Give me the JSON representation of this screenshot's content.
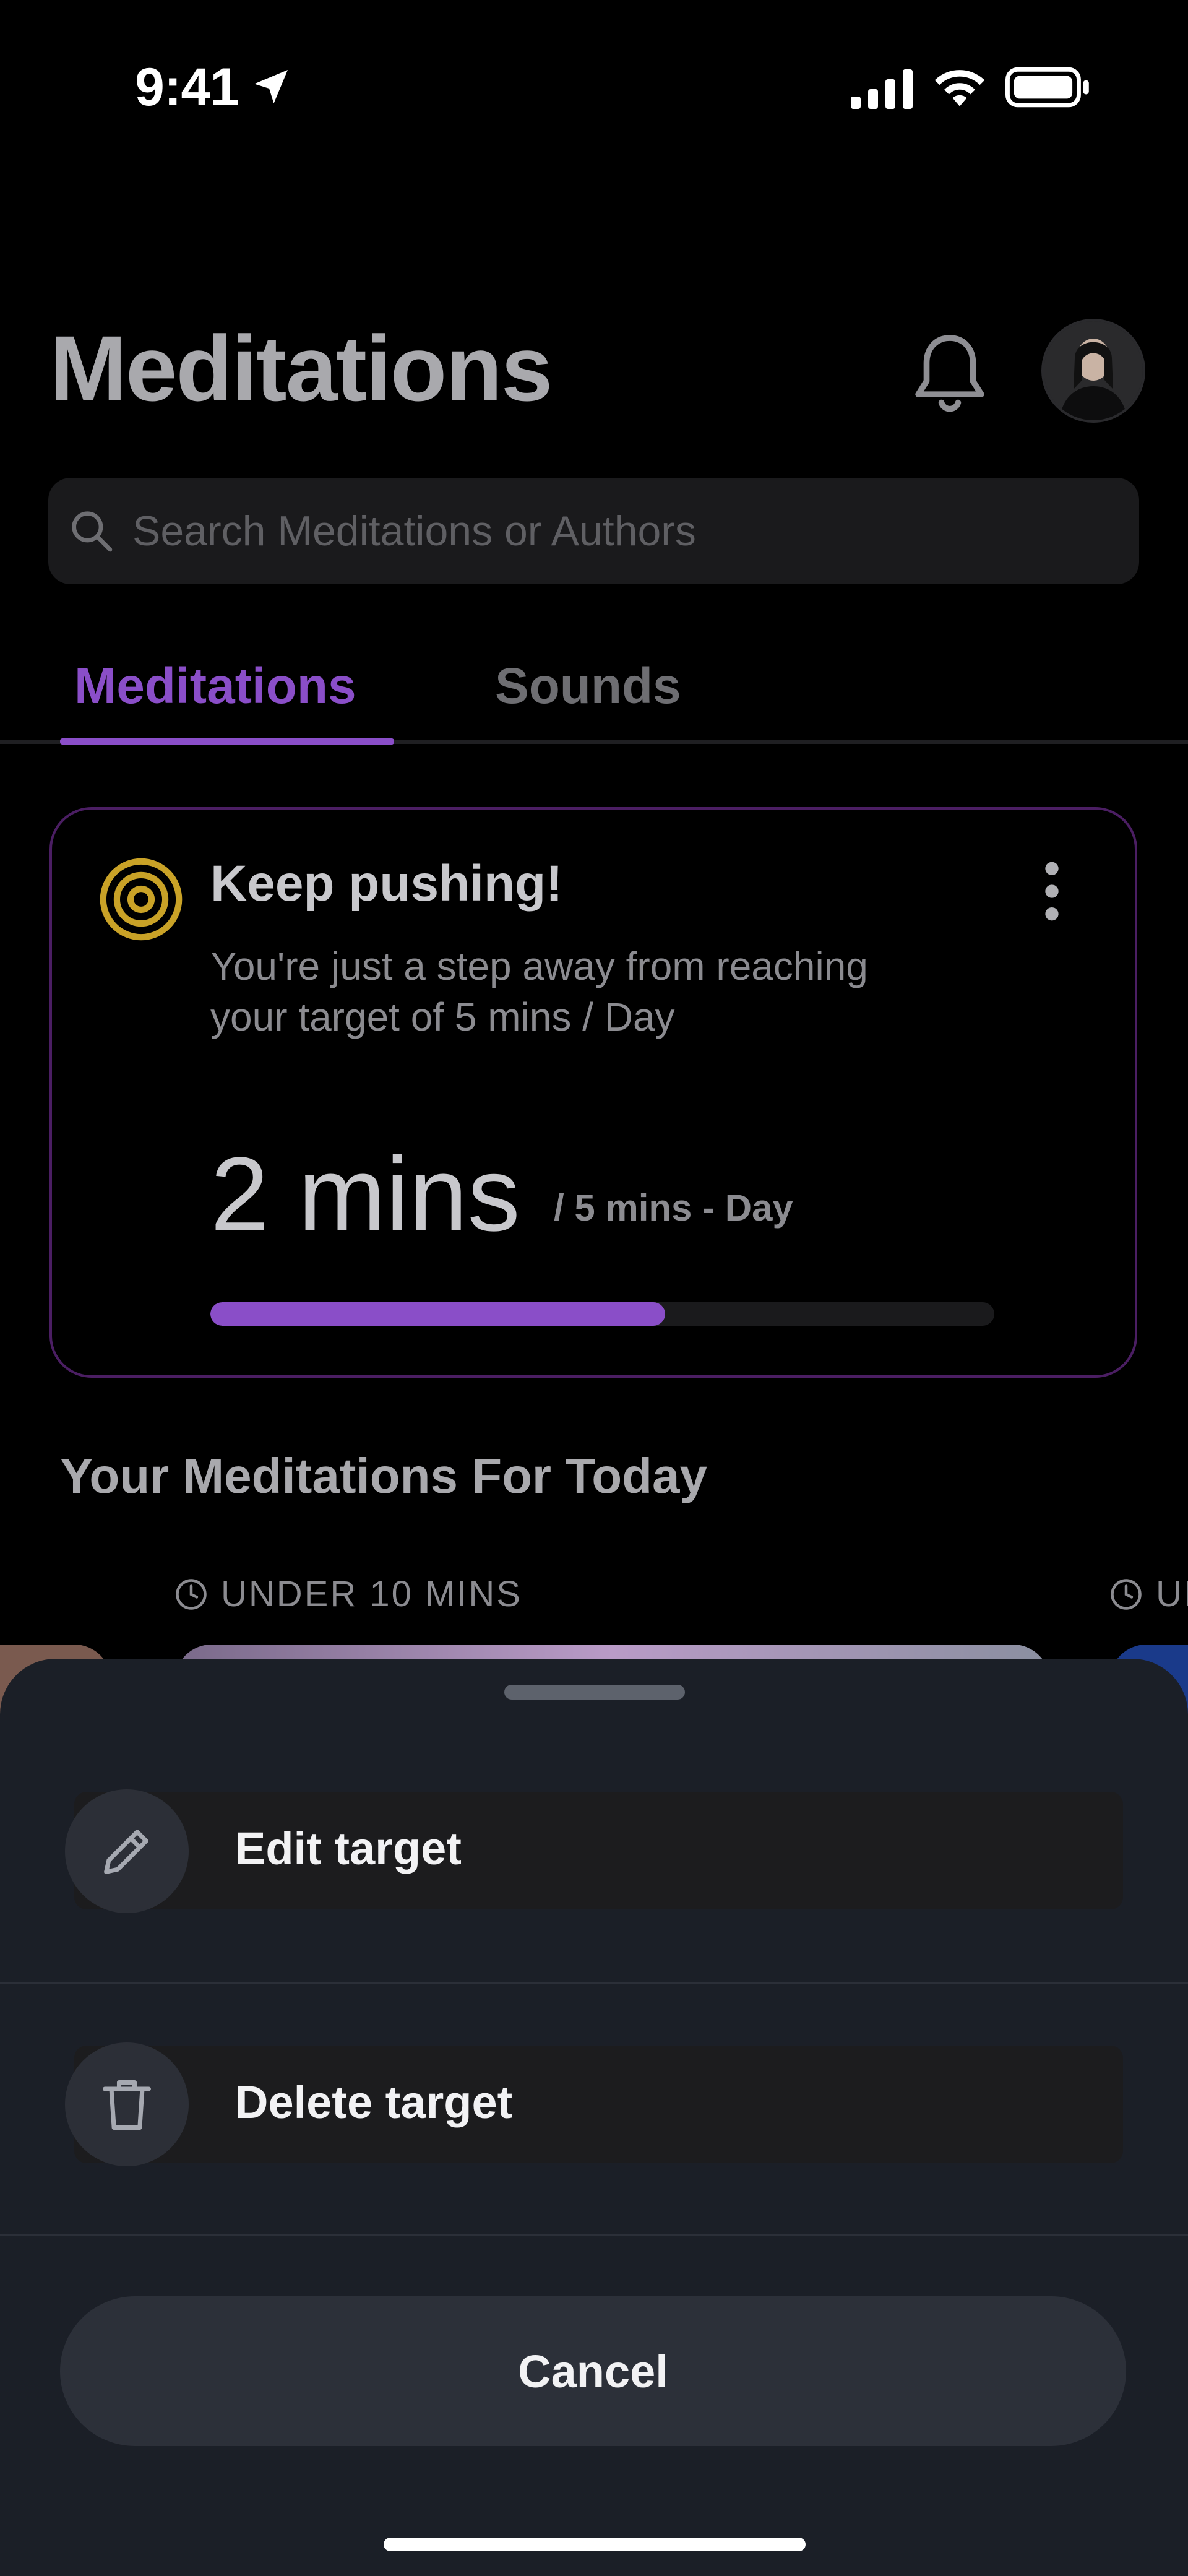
{
  "status_bar": {
    "time": "9:41",
    "icons": [
      "location-arrow-icon",
      "cellular-signal-icon",
      "wifi-icon",
      "battery-icon"
    ]
  },
  "header": {
    "title": "Meditations",
    "icons": [
      "bell-icon",
      "avatar"
    ]
  },
  "search": {
    "placeholder": "Search Meditations or Authors",
    "icon": "search-icon"
  },
  "tabs": [
    {
      "label": "Meditations",
      "active": true
    },
    {
      "label": "Sounds",
      "active": false
    }
  ],
  "target_card": {
    "icon": "target-icon",
    "title": "Keep pushing!",
    "description": "You're just a step away from reaching your target of 5 mins / Day",
    "current": "2 mins",
    "goal": "/ 5 mins - Day",
    "progress_fraction": 0.58,
    "colors": {
      "accent": "#8a4ec8",
      "target_icon": "#c9a227",
      "border": "#4b1e63"
    }
  },
  "section": {
    "title": "Your Meditations For Today",
    "duration_labels": [
      "UNDER 10 MINS",
      "UI"
    ]
  },
  "bottom_sheet": {
    "options": [
      {
        "label": "Edit target",
        "icon": "pencil-icon"
      },
      {
        "label": "Delete target",
        "icon": "trash-icon"
      }
    ],
    "cancel_label": "Cancel",
    "colors": {
      "background": "#1b1f27",
      "button": "#2c3039"
    }
  }
}
